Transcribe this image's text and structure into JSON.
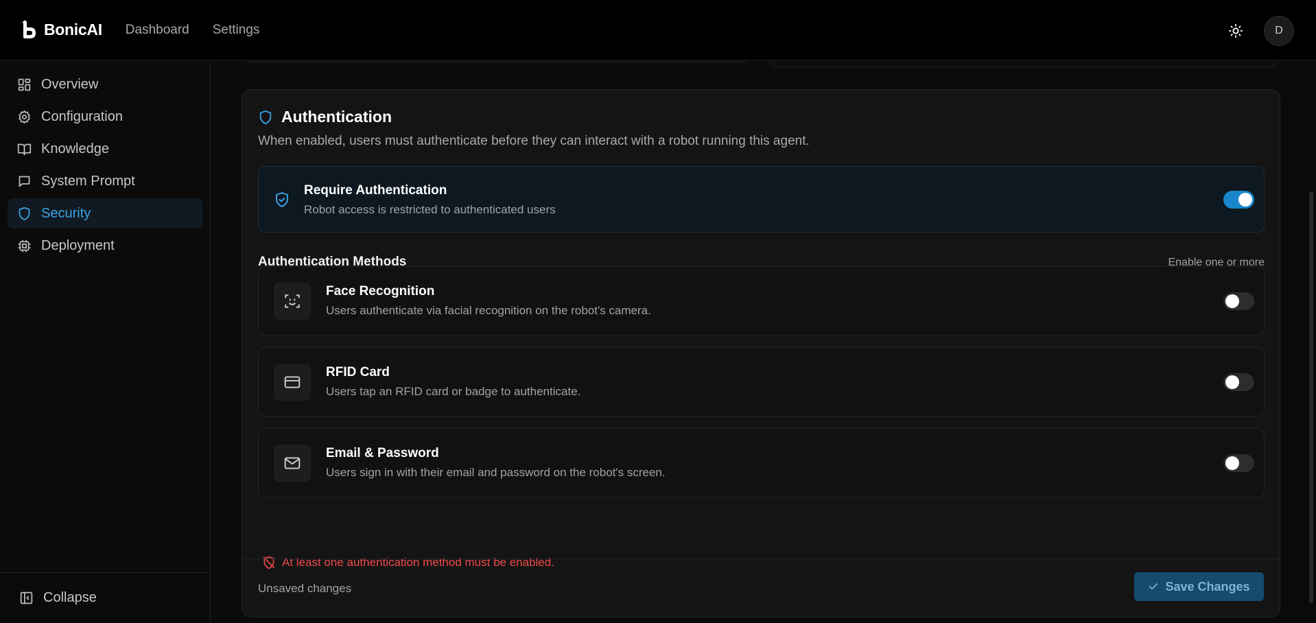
{
  "app": {
    "name": "BonicAI"
  },
  "nav": {
    "dashboard": "Dashboard",
    "settings": "Settings"
  },
  "user": {
    "initial": "D"
  },
  "sidebar": {
    "items": [
      {
        "label": "Overview",
        "icon": "grid-icon"
      },
      {
        "label": "Configuration",
        "icon": "gear-icon"
      },
      {
        "label": "Knowledge",
        "icon": "book-icon"
      },
      {
        "label": "System Prompt",
        "icon": "message-icon"
      },
      {
        "label": "Security",
        "icon": "shield-icon",
        "active": true
      },
      {
        "label": "Deployment",
        "icon": "chip-icon"
      }
    ],
    "collapse_label": "Collapse"
  },
  "auth": {
    "title": "Authentication",
    "description": "When enabled, users must authenticate before they can interact with a robot running this agent.",
    "require": {
      "title": "Require Authentication",
      "subtitle": "Robot access is restricted to authenticated users",
      "enabled": true
    },
    "methods_title": "Authentication Methods",
    "methods_hint": "Enable one or more",
    "methods": [
      {
        "title": "Face Recognition",
        "subtitle": "Users authenticate via facial recognition on the robot's camera.",
        "icon": "face-scan-icon",
        "enabled": false
      },
      {
        "title": "RFID Card",
        "subtitle": "Users tap an RFID card or badge to authenticate.",
        "icon": "card-icon",
        "enabled": false
      },
      {
        "title": "Email & Password",
        "subtitle": "Users sign in with their email and password on the robot's screen.",
        "icon": "mail-icon",
        "enabled": false
      }
    ],
    "warning": "At least one authentication method must be enabled.",
    "unsaved": "Unsaved changes",
    "save_label": "Save Changes"
  },
  "colors": {
    "accent": "#1a86cc",
    "active_text": "#3aa3e6",
    "error": "#ef4a4a"
  }
}
